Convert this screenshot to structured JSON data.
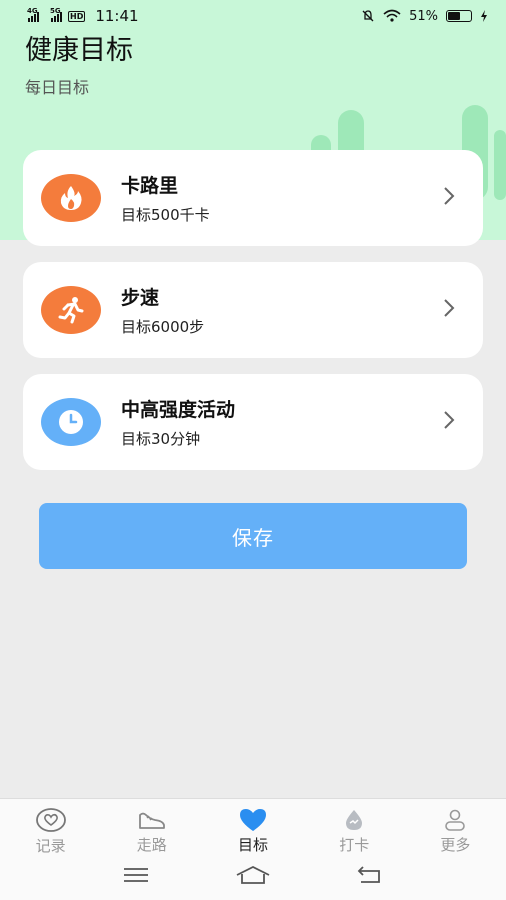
{
  "status_bar": {
    "sim1_label": "4G",
    "sim2_label": "5G",
    "hd_label": "HD",
    "time": "11:41",
    "battery_percent": "51%",
    "battery_level": 0.51
  },
  "header": {
    "title": "健康目标",
    "subtitle": "每日目标"
  },
  "goals": [
    {
      "name": "卡路里",
      "goal": "目标500千卡",
      "icon": "flame-icon",
      "color": "#f47c3c"
    },
    {
      "name": "步速",
      "goal": "目标6000步",
      "icon": "running-person-icon",
      "color": "#f47c3c"
    },
    {
      "name": "中高强度活动",
      "goal": "目标30分钟",
      "icon": "clock-icon",
      "color": "#64b0f8"
    }
  ],
  "save_label": "保存",
  "bottom_nav": [
    {
      "label": "记录",
      "icon": "heart-outline-icon",
      "active": false
    },
    {
      "label": "走路",
      "icon": "shoe-icon",
      "active": false
    },
    {
      "label": "目标",
      "icon": "heart-filled-icon",
      "active": true
    },
    {
      "label": "打卡",
      "icon": "drop-icon",
      "active": false
    },
    {
      "label": "更多",
      "icon": "person-icon",
      "active": false
    }
  ],
  "colors": {
    "hero_green": "#c8f7d8",
    "accent_blue": "#64b0f8",
    "accent_orange": "#f47c3c"
  }
}
